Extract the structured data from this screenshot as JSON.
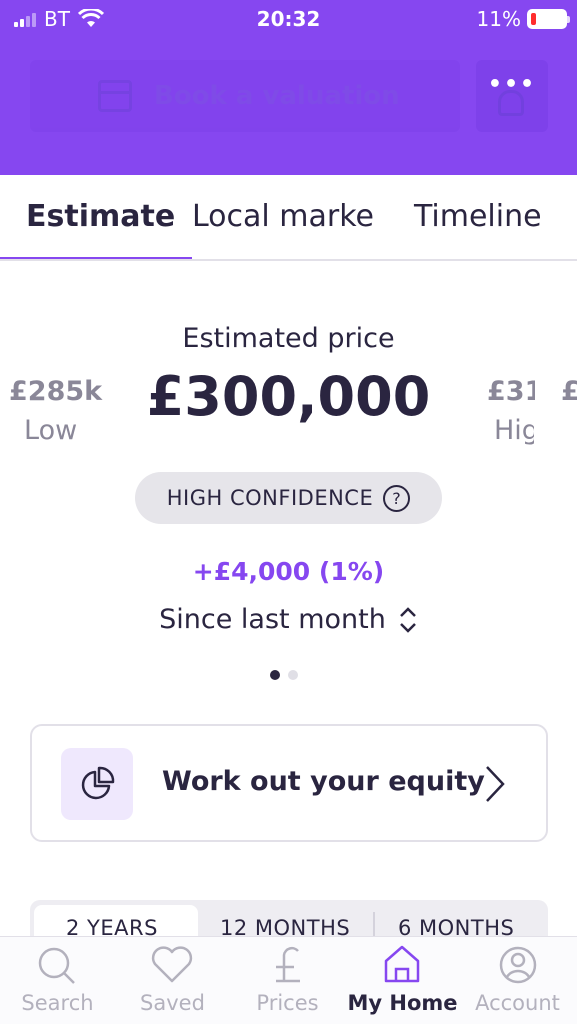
{
  "status_bar": {
    "carrier": "BT",
    "time": "20:32",
    "battery": "11%"
  },
  "header": {
    "book_label": "Book a valuation",
    "more_label": "•••"
  },
  "tabs": [
    {
      "label": "Estimate",
      "active": true
    },
    {
      "label": "Local marke",
      "active": false
    },
    {
      "label": "Timeline",
      "active": false
    }
  ],
  "estimate": {
    "label": "Estimated price",
    "value": "£300,000",
    "low_value": "£285k",
    "low_label": "Low",
    "high_value": "£31",
    "high_label": "Hig",
    "next_value": "£",
    "confidence": "HIGH CONFIDENCE",
    "confidence_help": "?",
    "change": "+£4,000 (1%)",
    "since": "Since last month",
    "page_count": 2,
    "page_index": 0
  },
  "equity_card": {
    "label": "Work out your equity",
    "chevron": "›"
  },
  "periods": [
    {
      "label": "2 YEARS",
      "selected": true
    },
    {
      "label": "12 MONTHS",
      "selected": false
    },
    {
      "label": "6 MONTHS",
      "selected": false
    }
  ],
  "nav": [
    {
      "label": "Search",
      "icon": "search-icon",
      "active": false
    },
    {
      "label": "Saved",
      "icon": "heart-icon",
      "active": false
    },
    {
      "label": "Prices",
      "icon": "pound-icon",
      "active": false
    },
    {
      "label": "My Home",
      "icon": "home-icon",
      "active": true
    },
    {
      "label": "Account",
      "icon": "account-icon",
      "active": false
    }
  ],
  "colors": {
    "brand": "#8647f0",
    "text": "#2a2540",
    "muted": "#b3b1bd"
  }
}
